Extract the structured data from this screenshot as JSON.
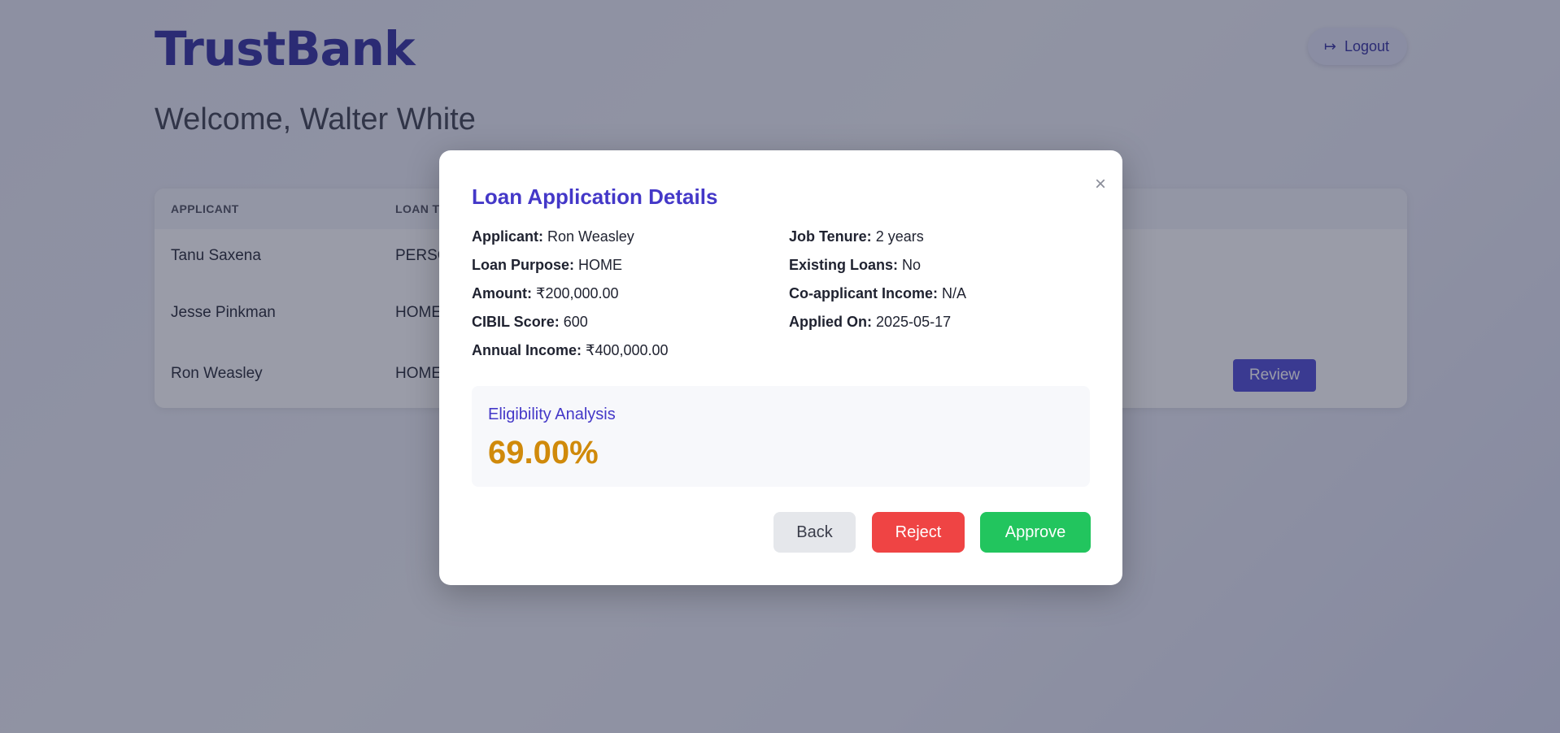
{
  "app": {
    "brand": "TrustBank",
    "logout_label": "Logout"
  },
  "welcome": "Welcome, Walter White",
  "table": {
    "headers": [
      "APPLICANT",
      "LOAN T"
    ],
    "rows": [
      {
        "applicant": "Tanu Saxena",
        "loan_type": "PERSC"
      },
      {
        "applicant": "Jesse Pinkman",
        "loan_type": "HOME"
      },
      {
        "applicant": "Ron Weasley",
        "loan_type": "HOME",
        "action": "Review"
      }
    ]
  },
  "modal": {
    "title": "Loan Application Details",
    "close": "×",
    "left_fields": [
      {
        "label": "Applicant:",
        "value": "Ron Weasley"
      },
      {
        "label": "Loan Purpose:",
        "value": "HOME"
      },
      {
        "label": "Amount:",
        "value": "₹200,000.00"
      },
      {
        "label": "CIBIL Score:",
        "value": "600"
      },
      {
        "label": "Annual Income:",
        "value": "₹400,000.00"
      }
    ],
    "right_fields": [
      {
        "label": "Job Tenure:",
        "value": "2 years"
      },
      {
        "label": "Existing Loans:",
        "value": "No"
      },
      {
        "label": "Co-applicant Income:",
        "value": "N/A"
      },
      {
        "label": "Applied On:",
        "value": "2025-05-17"
      }
    ],
    "eligibility": {
      "title": "Eligibility Analysis",
      "value": "69.00%"
    },
    "buttons": {
      "back": "Back",
      "reject": "Reject",
      "approve": "Approve"
    }
  },
  "colors": {
    "brand": "#2e2a9e",
    "accent": "#4438c8",
    "eligibility_value": "#d08a0b",
    "reject": "#ef4444",
    "approve": "#22c55e",
    "review": "#4a46d4"
  },
  "icons": {
    "logout": "logout-icon",
    "close": "close-icon"
  }
}
